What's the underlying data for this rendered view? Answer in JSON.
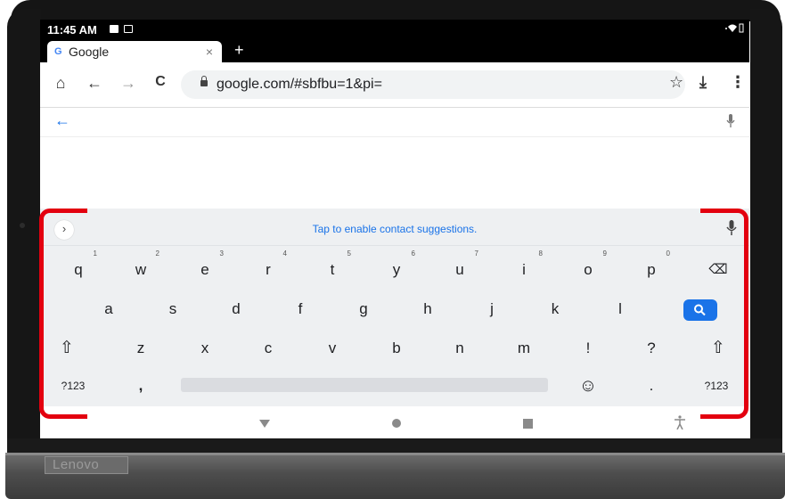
{
  "device": {
    "brand_logo": "Lenovo"
  },
  "status_bar": {
    "time": "11:45 AM"
  },
  "browser": {
    "tab": {
      "favicon": "G",
      "title": "Google",
      "close": "×"
    },
    "new_tab": "+",
    "nav": {
      "home": "⌂",
      "back": "←",
      "forward": "→",
      "reload": "C"
    },
    "url": "google.com/#sbfbu=1&pi=",
    "actions": {
      "bookmark": "☆",
      "download": "⤓",
      "menu": "⋮"
    }
  },
  "search_page": {
    "back": "←"
  },
  "keyboard": {
    "suggestion_expand": "›",
    "suggestion_text": "Tap to enable contact suggestions.",
    "row1": [
      {
        "key": "q",
        "hint": "1"
      },
      {
        "key": "w",
        "hint": "2"
      },
      {
        "key": "e",
        "hint": "3"
      },
      {
        "key": "r",
        "hint": "4"
      },
      {
        "key": "t",
        "hint": "5"
      },
      {
        "key": "y",
        "hint": "6"
      },
      {
        "key": "u",
        "hint": "7"
      },
      {
        "key": "i",
        "hint": "8"
      },
      {
        "key": "o",
        "hint": "9"
      },
      {
        "key": "p",
        "hint": "0"
      }
    ],
    "backspace": "⌫",
    "row2": [
      "a",
      "s",
      "d",
      "f",
      "g",
      "h",
      "j",
      "k",
      "l"
    ],
    "search_key": "🔍",
    "shift": "⇧",
    "row3": [
      "z",
      "x",
      "c",
      "v",
      "b",
      "n",
      "m",
      "!",
      "?"
    ],
    "symbols_left": "?123",
    "comma": ",",
    "emoji": "☺",
    "period": ".",
    "symbols_right": "?123"
  },
  "icons": {
    "mic": "mic-icon",
    "accessibility": "accessibility-icon"
  },
  "colors": {
    "highlight": "#e3000f",
    "accent": "#1a73e8"
  }
}
